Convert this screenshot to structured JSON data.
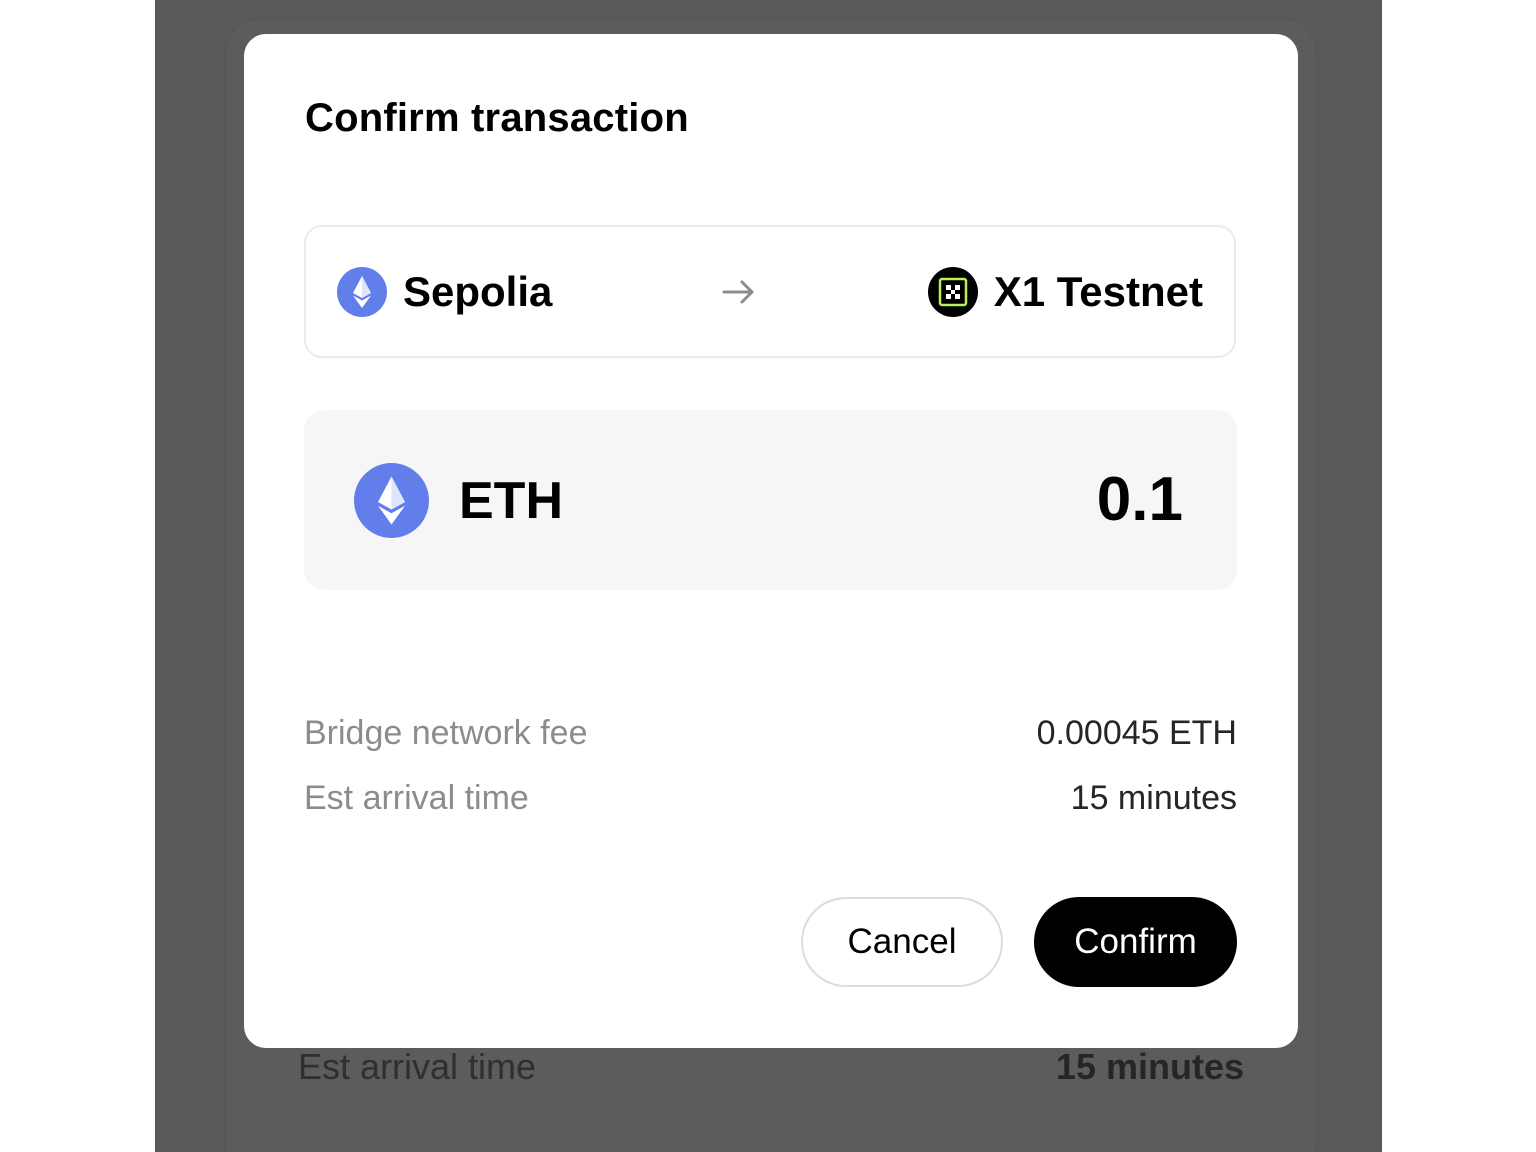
{
  "dialog": {
    "title": "Confirm transaction",
    "from_network": "Sepolia",
    "to_network": "X1 Testnet",
    "token_symbol": "ETH",
    "amount": "0.1",
    "details": [
      {
        "label": "Bridge network fee",
        "value": "0.00045 ETH"
      },
      {
        "label": "Est arrival time",
        "value": "15 minutes"
      }
    ],
    "cancel_label": "Cancel",
    "confirm_label": "Confirm"
  },
  "background": {
    "row_label": "Est arrival time",
    "row_value": "15 minutes"
  },
  "icons": {
    "from_network": "ethereum-icon",
    "to_network": "x1-network-icon",
    "arrow": "arrow-right-icon",
    "token": "ethereum-icon"
  },
  "colors": {
    "eth_blue": "#627eea",
    "x1_green": "#b4f15a",
    "confirm_bg": "#000000",
    "overlay": "#595959"
  }
}
